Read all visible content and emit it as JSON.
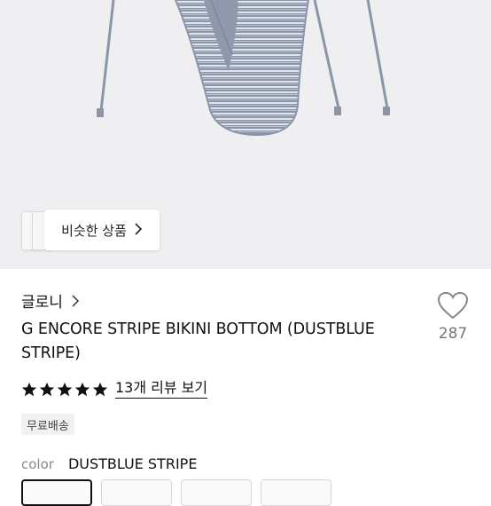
{
  "similar": {
    "label": "비슷한 상품"
  },
  "product": {
    "brand": "글로니",
    "title": "G ENCORE STRIPE BIKINI BOTTOM (DUSTBLUE STRIPE)",
    "likes": "287",
    "rating_stars": 5,
    "review_link": "13개 리뷰 보기",
    "badge": "무료배송",
    "color_label": "color",
    "color_value": "DUSTBLUE STRIPE",
    "swatch_count": 4
  },
  "colors": {
    "hero_bg": "#efeff1",
    "fabric_blue": "#8b95a8",
    "stripe_light": "#dfe4ee",
    "star": "#111111"
  }
}
